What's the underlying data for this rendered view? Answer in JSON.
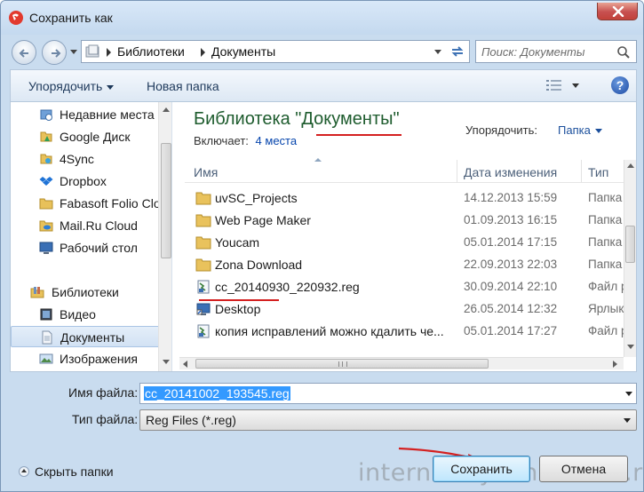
{
  "window": {
    "title": "Сохранить как",
    "close_label": "Закрыть"
  },
  "address": {
    "crumbs": [
      "Библиотеки",
      "Документы"
    ],
    "search_placeholder": "Поиск: Документы"
  },
  "toolbar": {
    "organize_label": "Упорядочить",
    "new_folder_label": "Новая папка",
    "help_label": "?"
  },
  "nav": {
    "items": [
      {
        "label": "Недавние места",
        "icon": "recent-places-icon"
      },
      {
        "label": "Google Диск",
        "icon": "google-drive-icon"
      },
      {
        "label": "4Sync",
        "icon": "4sync-icon"
      },
      {
        "label": "Dropbox",
        "icon": "dropbox-icon"
      },
      {
        "label": "Fabasoft Folio Clo",
        "icon": "folder-icon"
      },
      {
        "label": "Mail.Ru Cloud",
        "icon": "mailru-cloud-icon"
      },
      {
        "label": "Рабочий стол",
        "icon": "desktop-icon"
      },
      {
        "label": "Библиотеки",
        "icon": "libraries-icon"
      },
      {
        "label": "Видео",
        "icon": "video-library-icon"
      },
      {
        "label": "Документы",
        "icon": "documents-library-icon"
      },
      {
        "label": "Изображения",
        "icon": "pictures-library-icon"
      }
    ],
    "selected_index": 9
  },
  "library": {
    "title": "Библиотека \"Документы\"",
    "includes_label": "Включает:",
    "includes_link": "4 места",
    "arrange_label": "Упорядочить:",
    "arrange_value": "Папка"
  },
  "list": {
    "columns": [
      "Имя",
      "Дата изменения",
      "Тип"
    ],
    "rows": [
      {
        "name": "uvSC_Projects",
        "date": "14.12.2013 15:59",
        "type": "Папка",
        "icon": "folder"
      },
      {
        "name": "Web Page Maker",
        "date": "01.09.2013 16:15",
        "type": "Папка",
        "icon": "folder"
      },
      {
        "name": "Youcam",
        "date": "05.01.2014 17:15",
        "type": "Папка",
        "icon": "folder"
      },
      {
        "name": "Zona Download",
        "date": "22.09.2013 22:03",
        "type": "Папка",
        "icon": "folder"
      },
      {
        "name": "cc_20140930_220932.reg",
        "date": "30.09.2014 22:10",
        "type": "Файл р",
        "icon": "reg"
      },
      {
        "name": "Desktop",
        "date": "26.05.2014 12:32",
        "type": "Ярлык",
        "icon": "shortcut"
      },
      {
        "name": "копия исправлений можно кдалить че...",
        "date": "05.01.2014 17:27",
        "type": "Файл р",
        "icon": "reg"
      }
    ]
  },
  "form": {
    "filename_label": "Имя файла:",
    "filename_value": "cc_20141002_193545.reg",
    "filetype_label": "Тип файла:",
    "filetype_value": "Reg Files (*.reg)"
  },
  "footer": {
    "hide_folders_label": "Скрыть папки",
    "save_label": "Сохранить",
    "cancel_label": "Отмена",
    "watermark": "internetdlyachainikov.ru"
  },
  "colors": {
    "accent": "#3399ff",
    "library_title": "#1e5c2e",
    "annotation_red": "#d42020"
  }
}
